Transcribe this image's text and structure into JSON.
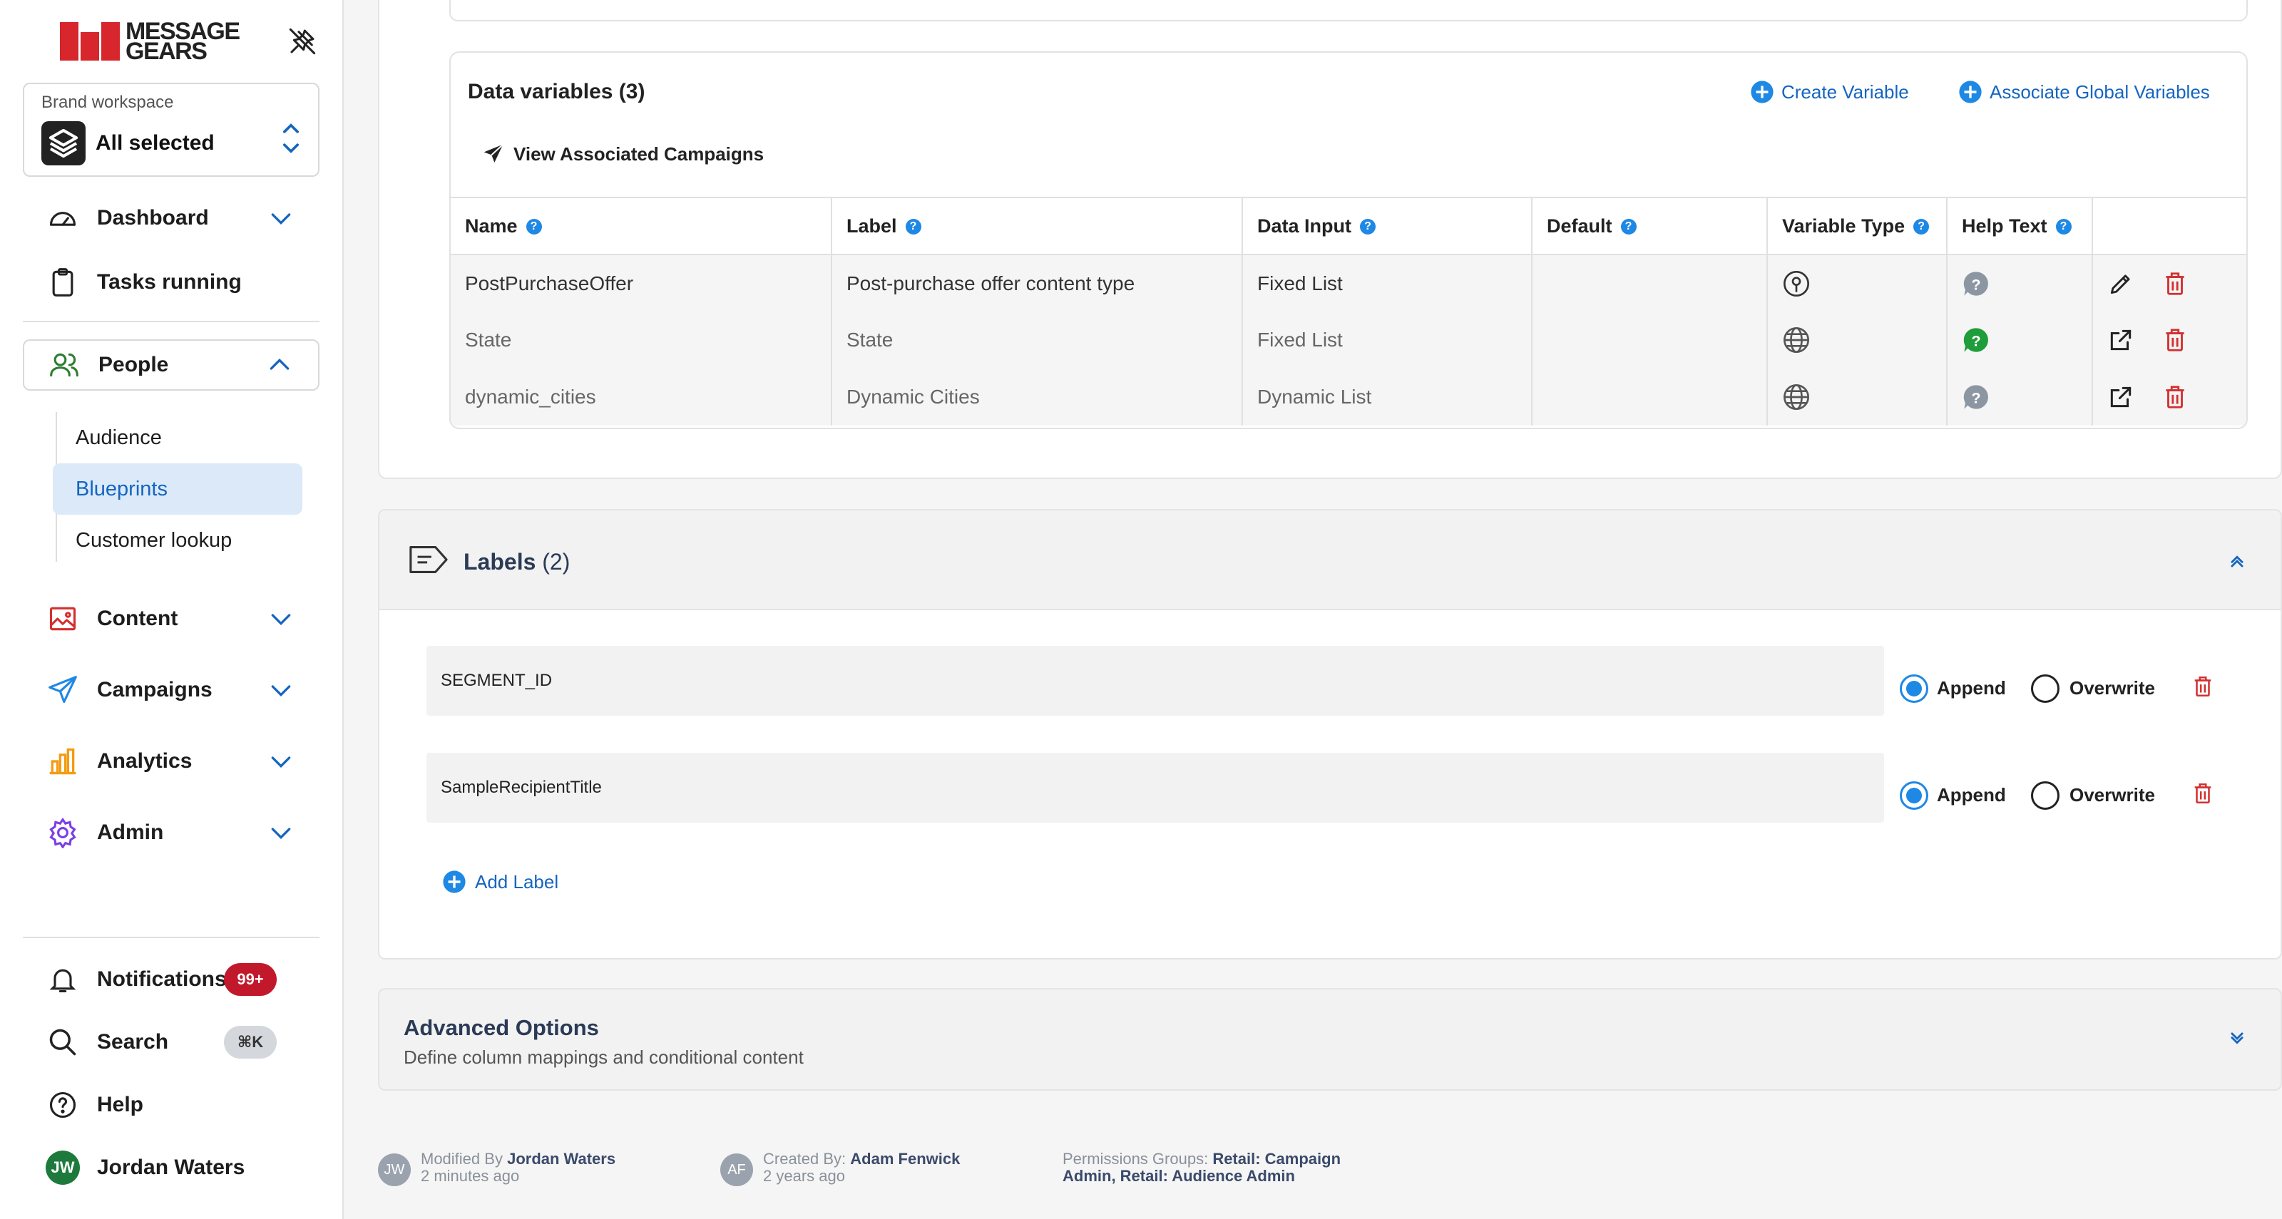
{
  "brand": {
    "name_line1": "MESSAGE",
    "name_line2": "GEARS",
    "accent": "#d7262c"
  },
  "workspace": {
    "caption": "Brand workspace",
    "value": "All selected"
  },
  "nav": {
    "dashboard": "Dashboard",
    "tasks": "Tasks running",
    "people": "People",
    "people_sub": [
      "Audience",
      "Blueprints",
      "Customer lookup"
    ],
    "content": "Content",
    "campaigns": "Campaigns",
    "analytics": "Analytics",
    "admin": "Admin",
    "notifications": "Notifications",
    "notifications_badge": "99+",
    "search": "Search",
    "search_shortcut": "⌘K",
    "help": "Help",
    "user_initials": "JW",
    "user_name": "Jordan Waters"
  },
  "data_variables": {
    "title": "Data variables",
    "count": "(3)",
    "create_label": "Create Variable",
    "associate_label": "Associate Global Variables",
    "view_campaigns": "View Associated Campaigns",
    "columns": [
      "Name",
      "Label",
      "Data Input",
      "Default",
      "Variable Type",
      "Help Text"
    ],
    "rows": [
      {
        "name": "PostPurchaseOffer",
        "label": "Post-purchase offer content type",
        "input": "Fixed List",
        "default": "",
        "type_icon": "location-pin-icon",
        "help_icon": "help-bubble-gray-icon"
      },
      {
        "name": "State",
        "label": "State",
        "input": "Fixed List",
        "default": "",
        "type_icon": "globe-icon",
        "help_icon": "help-bubble-green-icon"
      },
      {
        "name": "dynamic_cities",
        "label": "Dynamic Cities",
        "input": "Dynamic List",
        "default": "",
        "type_icon": "globe-icon",
        "help_icon": "help-bubble-gray-icon"
      }
    ]
  },
  "labels": {
    "title": "Labels",
    "count": "(2)",
    "items": [
      {
        "value": "SEGMENT_ID",
        "mode": "append"
      },
      {
        "value": "SampleRecipientTitle",
        "mode": "append"
      }
    ],
    "append_label": "Append",
    "overwrite_label": "Overwrite",
    "add_label": "Add Label"
  },
  "advanced": {
    "title": "Advanced Options",
    "subtitle": "Define column mappings and conditional content"
  },
  "footer": {
    "modified_initials": "JW",
    "modified_prefix": "Modified By",
    "modified_by": "Jordan Waters",
    "modified_time": "2 minutes ago",
    "created_initials": "AF",
    "created_prefix": "Created By:",
    "created_by": "Adam Fenwick",
    "created_time": "2 years ago",
    "permissions_prefix": "Permissions Groups:",
    "permissions_line1": "Retail: Campaign",
    "permissions_line2": "Admin, Retail: Audience Admin"
  },
  "colors": {
    "link": "#1565c0",
    "primary": "#1e88e5",
    "danger": "#d32f2f",
    "people_icon": "#2e7d32",
    "content_icon": "#d32f2f",
    "analytics_icon": "#f39c12",
    "admin_icon": "#7b3fe4"
  }
}
